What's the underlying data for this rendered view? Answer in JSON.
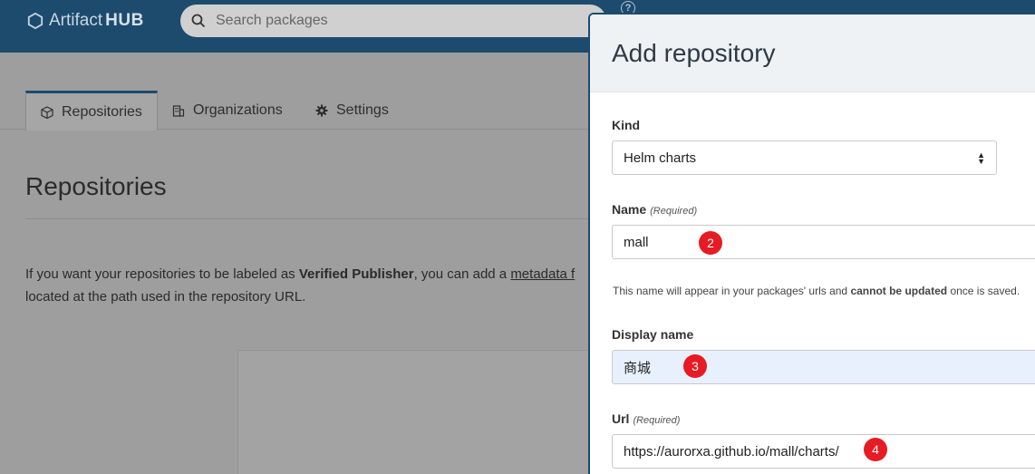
{
  "app": {
    "logo_light": "Artifact",
    "logo_bold": "HUB",
    "search_placeholder": "Search packages",
    "help_glyph": "?"
  },
  "tabs": [
    {
      "label": "Repositories",
      "icon": "package-icon",
      "active": true
    },
    {
      "label": "Organizations",
      "icon": "building-icon",
      "active": false
    },
    {
      "label": "Settings",
      "icon": "gear-icon",
      "active": false
    }
  ],
  "page": {
    "title": "Repositories",
    "intro_part1": "If you want your repositories to be labeled as ",
    "intro_bold": "Verified Publisher",
    "intro_part2": ", you can add a ",
    "intro_link": "metadata f",
    "intro_line2": "located at the path used in the repository URL."
  },
  "modal": {
    "title": "Add repository",
    "kind_label": "Kind",
    "kind_value": "Helm charts",
    "name_label": "Name",
    "name_required": "(Required)",
    "name_value": "mall",
    "hint_part1": "This name will appear in your packages' urls and ",
    "hint_bold": "cannot be updated",
    "hint_part2": " once is saved.",
    "display_name_label": "Display name",
    "display_name_value": "商城",
    "url_label": "Url",
    "url_required": "(Required)",
    "url_value": "https://aurorxa.github.io/mall/charts/"
  },
  "markers": [
    "2",
    "3",
    "4"
  ],
  "colors": {
    "topbar": "#1c4b6e",
    "marker": "#e61b23",
    "autofill": "#e8f0fe"
  }
}
